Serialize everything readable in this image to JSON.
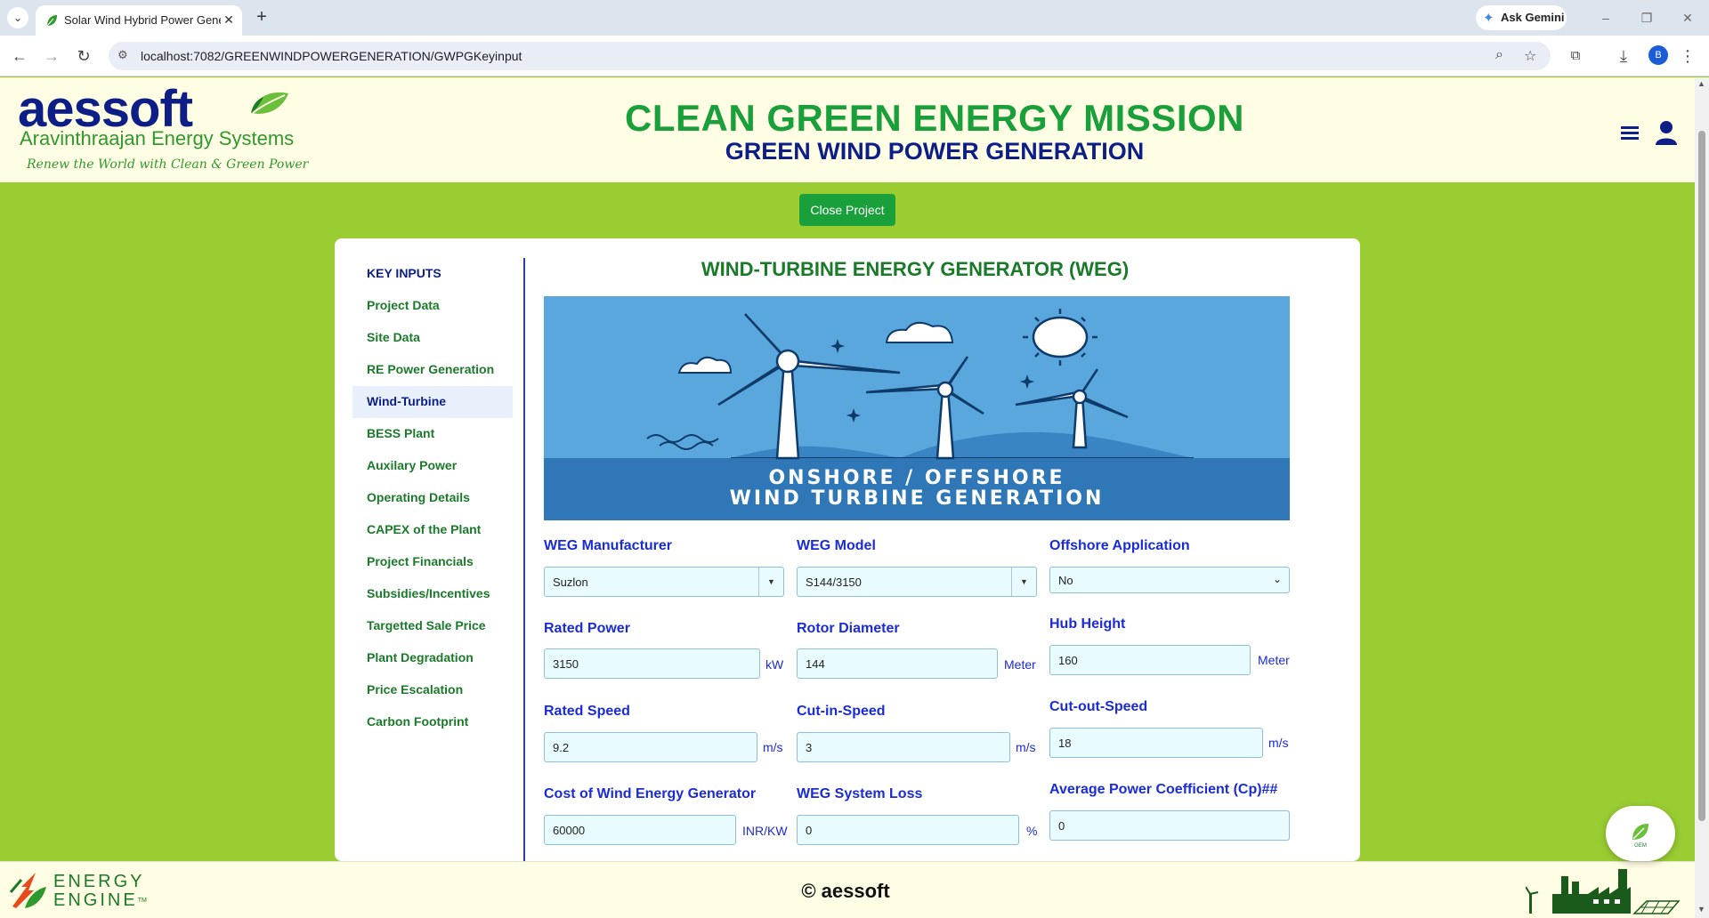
{
  "browser": {
    "tab_title": "Solar Wind Hybrid Power Gene",
    "url": "localhost:7082/GREENWINDPOWERGENERATION/GWPGKeyinput",
    "gemini_label": "Ask Gemini",
    "profile_initial": "B"
  },
  "header": {
    "logo_text": "aessoft",
    "logo_subtitle": "Aravinthraajan Energy Systems",
    "logo_tagline": "Renew the World with Clean & Green Power",
    "mission": "CLEAN GREEN ENERGY MISSION",
    "subtitle": "GREEN WIND POWER GENERATION"
  },
  "toolbar": {
    "close_project": "Close Project"
  },
  "sidebar": {
    "heading": "KEY INPUTS",
    "items": [
      {
        "label": "Project Data"
      },
      {
        "label": "Site Data"
      },
      {
        "label": "RE Power Generation"
      },
      {
        "label": "Wind-Turbine",
        "active": true
      },
      {
        "label": "BESS Plant"
      },
      {
        "label": "Auxilary Power"
      },
      {
        "label": "Operating Details"
      },
      {
        "label": "CAPEX of the Plant"
      },
      {
        "label": "Project Financials"
      },
      {
        "label": "Subsidies/Incentives"
      },
      {
        "label": "Targetted Sale Price"
      },
      {
        "label": "Plant Degradation"
      },
      {
        "label": "Price Escalation"
      },
      {
        "label": "Carbon Footprint"
      }
    ]
  },
  "main": {
    "title": "WIND-TURBINE ENERGY GENERATOR (WEG)",
    "banner_line1": "ONSHORE / OFFSHORE",
    "banner_line2": "WIND TURBINE GENERATION",
    "fields": {
      "manufacturer": {
        "label": "WEG Manufacturer",
        "value": "Suzlon"
      },
      "model": {
        "label": "WEG Model",
        "value": "S144/3150"
      },
      "offshore": {
        "label": "Offshore Application",
        "value": "No"
      },
      "rated_power": {
        "label": "Rated Power",
        "value": "3150",
        "unit": "kW"
      },
      "rotor_diameter": {
        "label": "Rotor Diameter",
        "value": "144",
        "unit": "Meter"
      },
      "hub_height": {
        "label": "Hub Height",
        "value": "160",
        "unit": "Meter"
      },
      "rated_speed": {
        "label": "Rated Speed",
        "value": "9.2",
        "unit": "m/s"
      },
      "cut_in_speed": {
        "label": "Cut-in-Speed",
        "value": "3",
        "unit": "m/s"
      },
      "cut_out_speed": {
        "label": "Cut-out-Speed",
        "value": "18",
        "unit": "m/s"
      },
      "cost": {
        "label": "Cost of Wind Energy Generator",
        "value": "60000",
        "unit": "INR/KW"
      },
      "system_loss": {
        "label": "WEG System Loss",
        "value": "0",
        "unit": "%"
      },
      "power_coefficient": {
        "label": "Average Power Coefficient (Cp)##",
        "value": "0"
      }
    }
  },
  "footer": {
    "brand_line1": "ENERGY",
    "brand_line2": "ENGINE",
    "trademark": "TM",
    "copyright": "© aessoft",
    "fab_label": "GEM"
  },
  "colors": {
    "page_bg": "#9acd32",
    "header_bg": "#fffde4",
    "brand_green": "#1aa03a",
    "brand_navy": "#0d1f87",
    "label_blue": "#1a2bd8",
    "input_bg": "#e8fbff"
  }
}
